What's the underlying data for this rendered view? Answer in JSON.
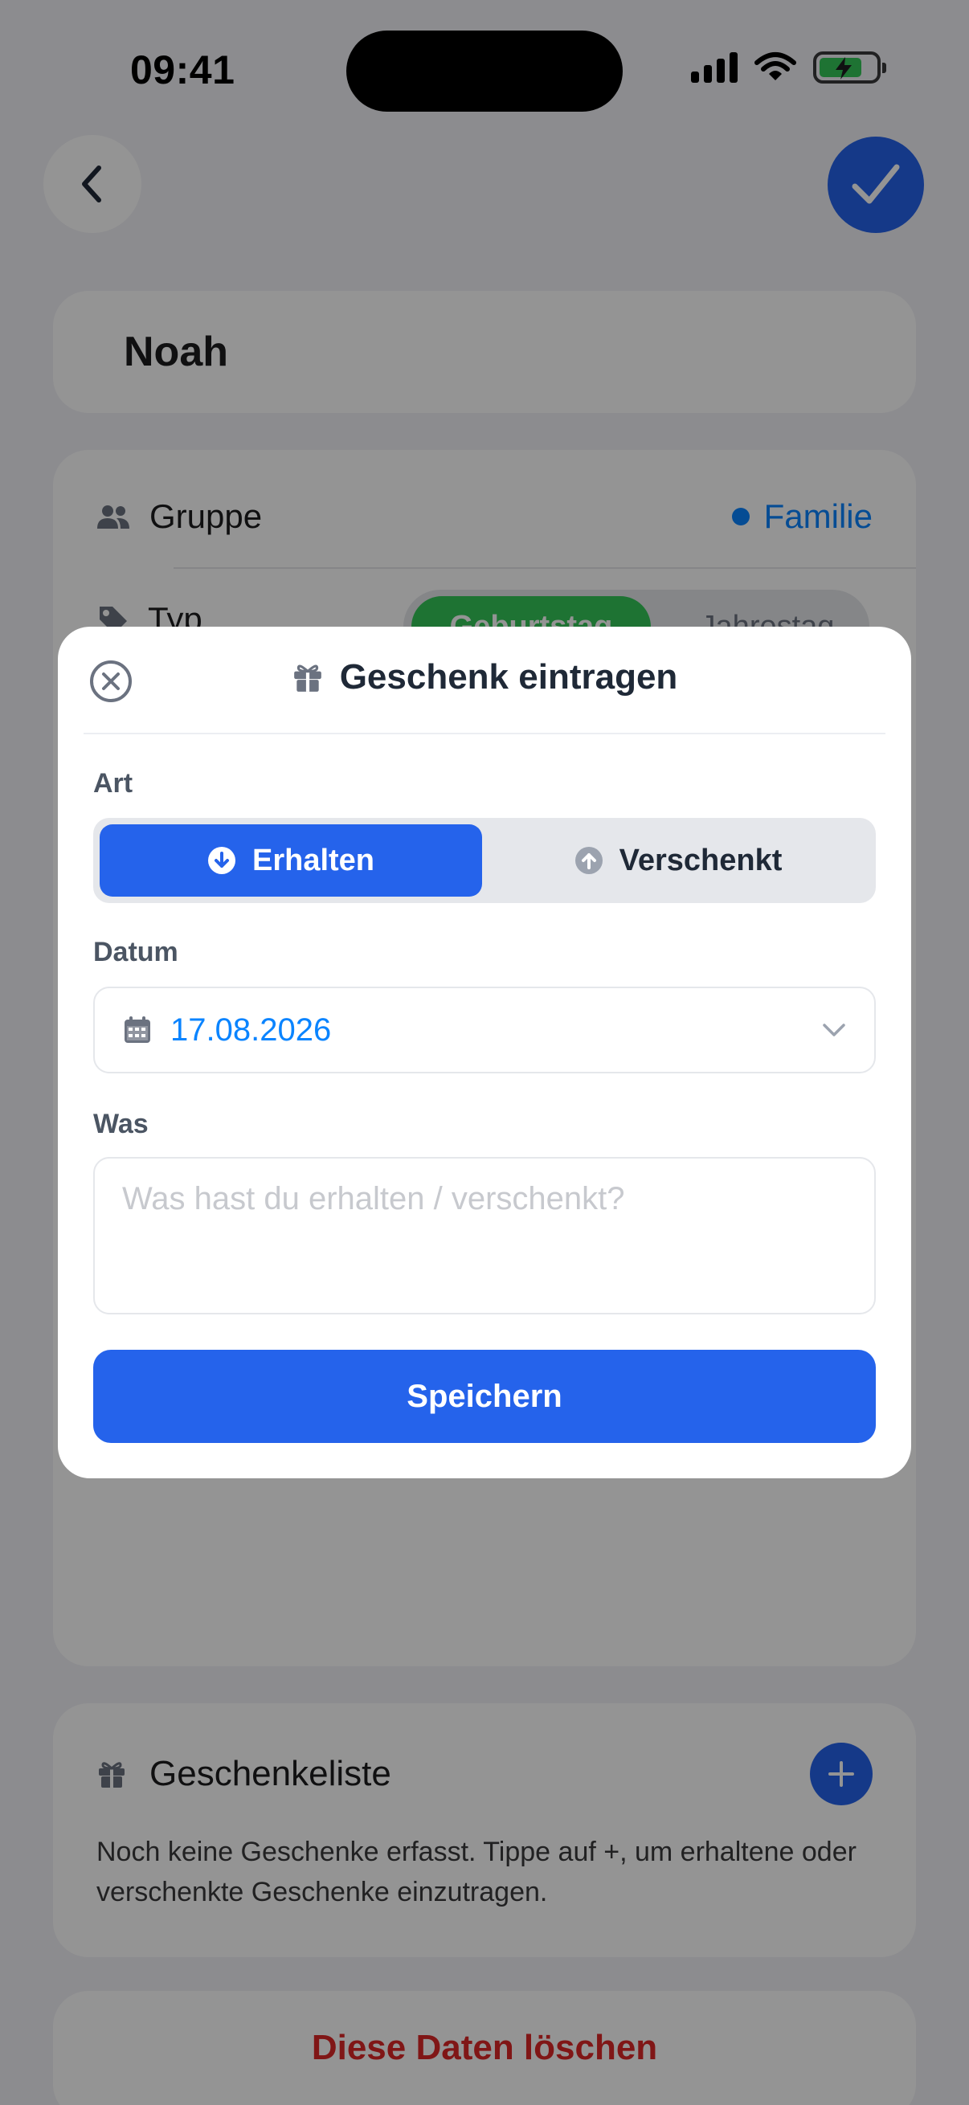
{
  "status_bar": {
    "time": "09:41"
  },
  "nav": {
    "back_icon": "chevron-left-icon",
    "save_icon": "checkmark-icon"
  },
  "contact": {
    "name": "Noah"
  },
  "details": {
    "group_label": "Gruppe",
    "group_value": "Familie",
    "group_color": "#0a84ff",
    "type_label": "Typ",
    "type_options": [
      "Geburtstag",
      "Jahrestag"
    ],
    "type_selected": "Geburtstag"
  },
  "gift_list": {
    "title": "Geschenkeliste",
    "empty_text": "Noch keine Geschenke erfasst. Tippe auf +, um erhaltene oder verschenkte Geschenke einzutragen."
  },
  "delete_label": "Diese Daten löschen",
  "modal": {
    "title": "Geschenk eintragen",
    "art_label": "Art",
    "kind_options": {
      "received": "Erhalten",
      "given": "Verschenkt"
    },
    "kind_selected": "Erhalten",
    "date_label": "Datum",
    "date_value": "17.08.2026",
    "what_label": "Was",
    "what_placeholder": "Was hast du erhalten / verschenkt?",
    "what_value": "",
    "save_label": "Speichern"
  },
  "colors": {
    "accent": "#2563eb",
    "success": "#34c759",
    "danger": "#dc2626",
    "link": "#0a84ff"
  }
}
